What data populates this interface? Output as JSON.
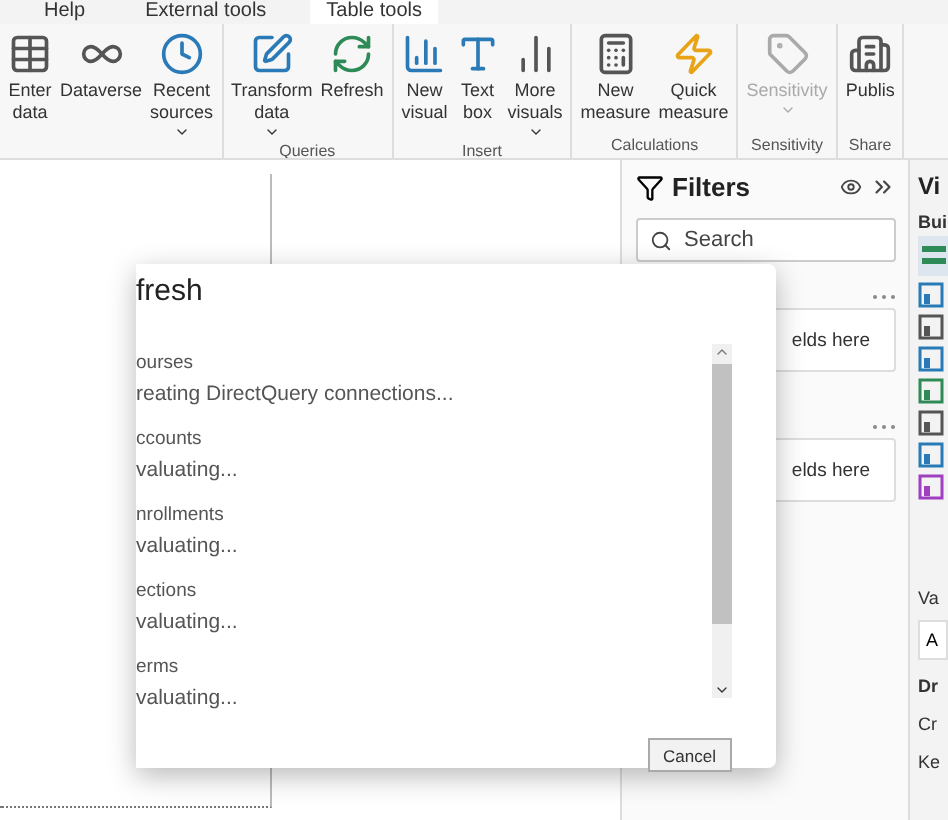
{
  "ribbon_tabs": [
    {
      "label": "Help",
      "selected": false
    },
    {
      "label": "External tools",
      "selected": false
    },
    {
      "label": "Table tools",
      "selected": true
    }
  ],
  "ribbon_groups": [
    {
      "buttons": [
        {
          "lines": [
            "Enter",
            "data"
          ],
          "dropdown": false,
          "disabled": false
        },
        {
          "lines": [
            "Dataverse"
          ],
          "dropdown": false,
          "disabled": false
        },
        {
          "lines": [
            "Recent",
            "sources"
          ],
          "dropdown": true,
          "disabled": false
        }
      ]
    },
    {
      "label": "Queries",
      "buttons": [
        {
          "lines": [
            "Transform",
            "data"
          ],
          "dropdown": true,
          "disabled": false
        },
        {
          "lines": [
            "Refresh"
          ],
          "dropdown": false,
          "disabled": false
        }
      ]
    },
    {
      "label": "Insert",
      "buttons": [
        {
          "lines": [
            "New",
            "visual"
          ],
          "dropdown": false,
          "disabled": false
        },
        {
          "lines": [
            "Text",
            "box"
          ],
          "dropdown": false,
          "disabled": false
        },
        {
          "lines": [
            "More",
            "visuals"
          ],
          "dropdown": true,
          "disabled": false
        }
      ]
    },
    {
      "label": "Calculations",
      "buttons": [
        {
          "lines": [
            "New",
            "measure"
          ],
          "dropdown": false,
          "disabled": false
        },
        {
          "lines": [
            "Quick",
            "measure"
          ],
          "dropdown": false,
          "disabled": false
        }
      ]
    },
    {
      "label": "Sensitivity",
      "buttons": [
        {
          "lines": [
            "Sensitivity"
          ],
          "dropdown": true,
          "disabled": true
        }
      ]
    },
    {
      "label": "Share",
      "buttons": [
        {
          "lines": [
            "Publis"
          ],
          "dropdown": false,
          "disabled": false
        }
      ]
    }
  ],
  "filters": {
    "title": "Filters",
    "search": {
      "placeholder": "Search"
    },
    "wells": [
      {
        "text": "elds here"
      },
      {
        "text": "elds here"
      }
    ]
  },
  "visualizations": {
    "title": "Vi",
    "build_label": "Bui",
    "values_label": "Va",
    "value_field": "A",
    "drill_label": "Dr",
    "drill_items": [
      "Cr",
      "Ke"
    ]
  },
  "dialog": {
    "title": "fresh",
    "items": [
      {
        "name": "ourses",
        "status": "reating DirectQuery connections..."
      },
      {
        "name": "ccounts",
        "status": "valuating..."
      },
      {
        "name": "nrollments",
        "status": "valuating..."
      },
      {
        "name": "ections",
        "status": "valuating..."
      },
      {
        "name": "erms",
        "status": "valuating..."
      }
    ],
    "cancel": "Cancel"
  }
}
